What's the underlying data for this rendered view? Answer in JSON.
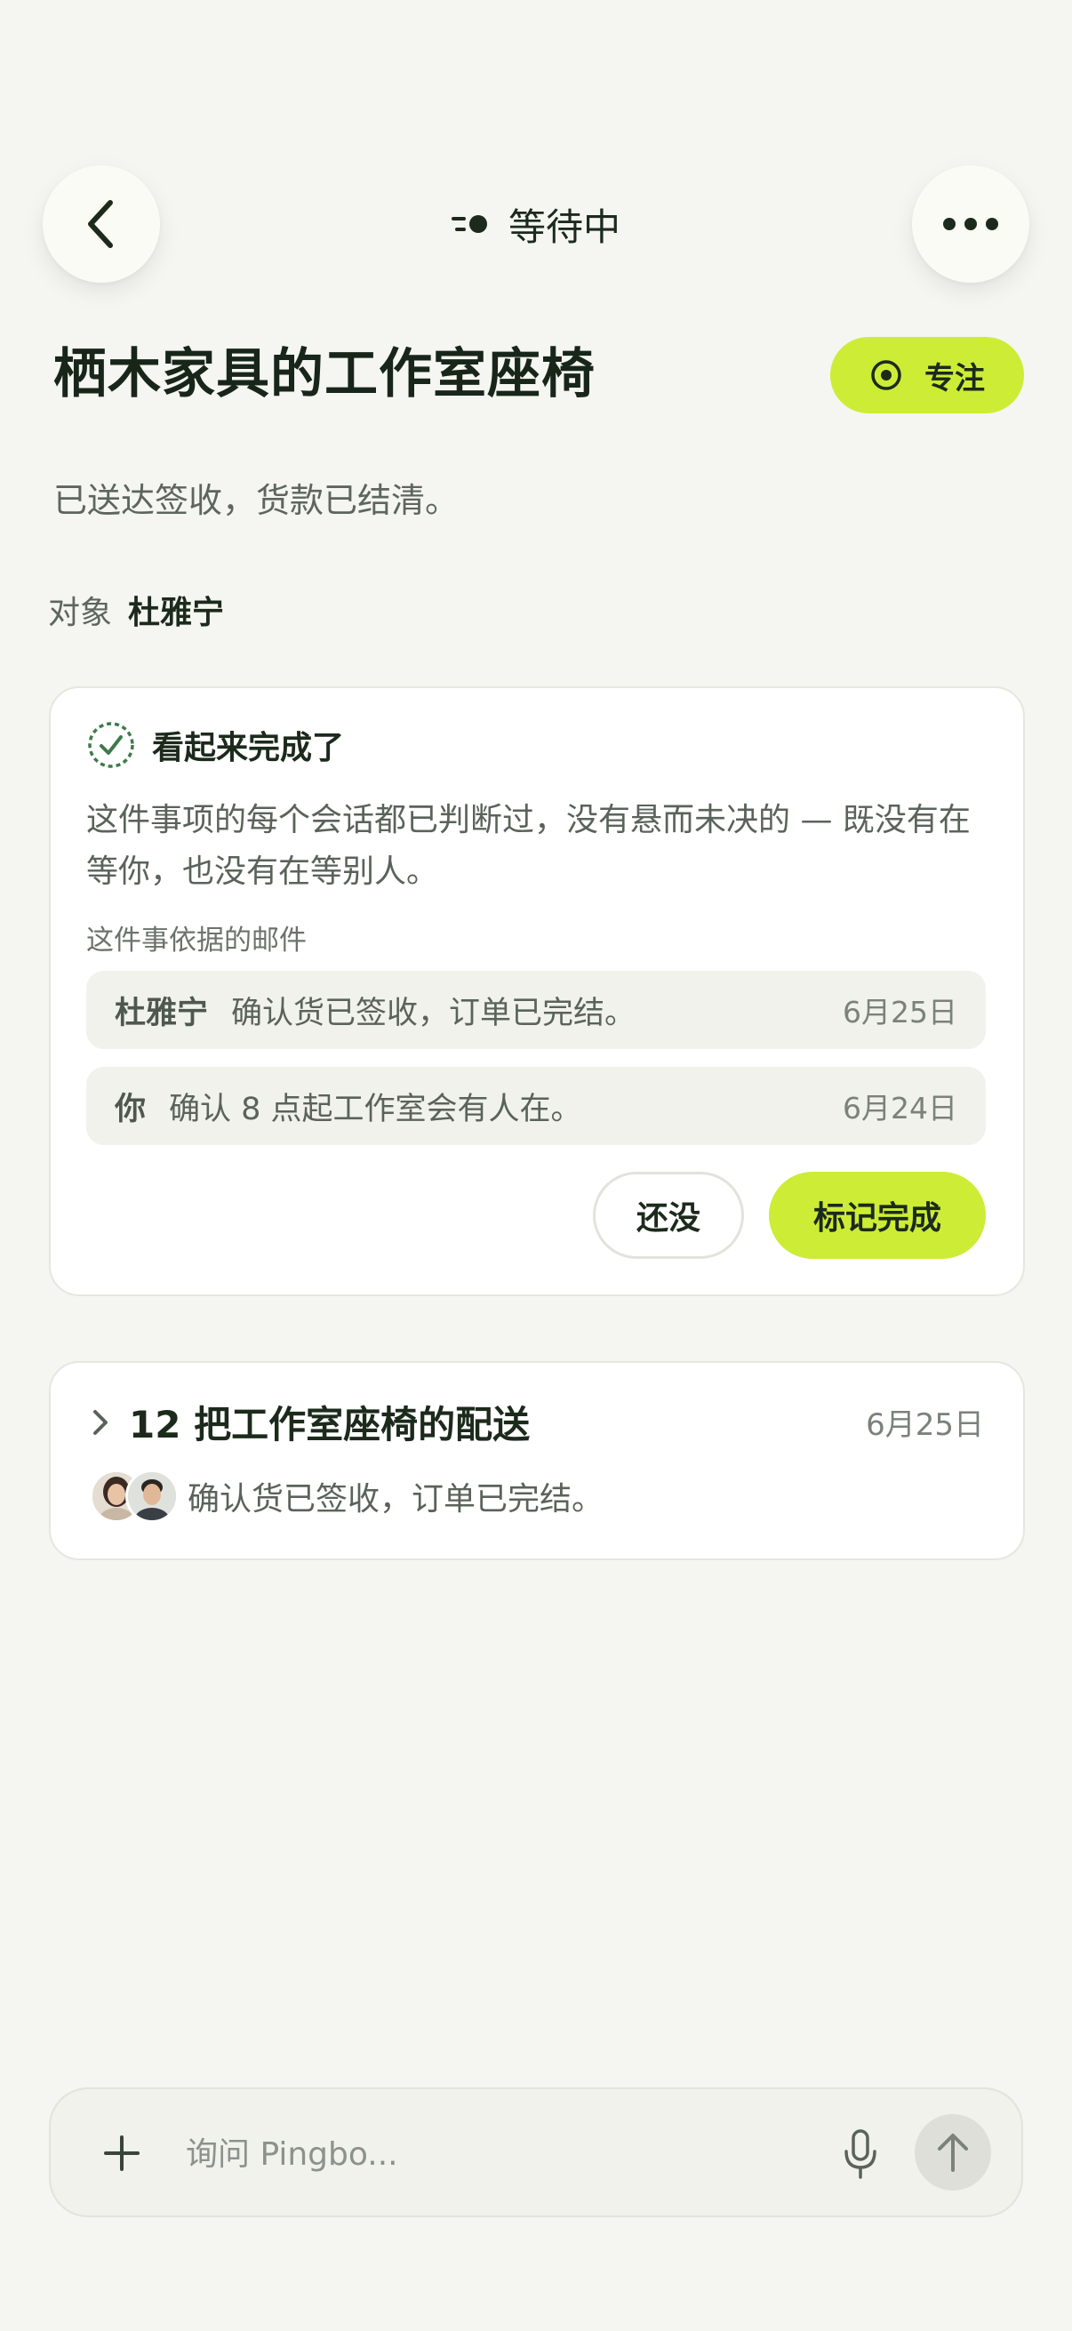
{
  "header": {
    "status_label": "等待中",
    "icons": {
      "back": "chevron-left-icon",
      "more": "more-horizontal-icon",
      "status": "waiting-dots-icon"
    }
  },
  "matter": {
    "title": "栖木家具的工作室座椅",
    "focus_label": "专注",
    "subtitle": "已送达签收，货款已结清。",
    "subject_label": "对象",
    "subject_value": "杜雅宁"
  },
  "completion_card": {
    "title": "看起来完成了",
    "description": "这件事项的每个会话都已判断过，没有悬而未决的 — 既没有在等你，也没有在等别人。",
    "evidence_label": "这件事依据的邮件",
    "emails": [
      {
        "sender": "杜雅宁",
        "text": "确认货已签收，订单已完结。",
        "date": "6月25日"
      },
      {
        "sender": "你",
        "text": "确认 8 点起工作室会有人在。",
        "date": "6月24日"
      }
    ],
    "not_yet_label": "还没",
    "mark_done_label": "标记完成"
  },
  "thread": {
    "title": "12 把工作室座椅的配送",
    "date": "6月25日",
    "snippet": "确认货已签收，订单已完结。"
  },
  "composer": {
    "placeholder": "询问 Pingbo..."
  },
  "colors": {
    "background": "#f5f5f1",
    "accent": "#cdec35",
    "text_primary": "#1c2a1c",
    "text_secondary": "#5a635a",
    "check_green": "#3f7a4a"
  }
}
